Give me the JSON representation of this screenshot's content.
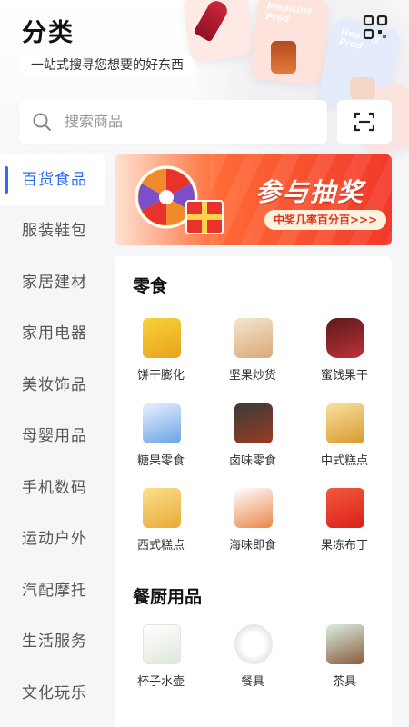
{
  "header": {
    "title": "分类",
    "subtitle": "一站式搜寻您想要的好东西",
    "deco_texts": [
      "Medicine Prod",
      "Healthy Prod"
    ]
  },
  "search": {
    "placeholder": "搜索商品"
  },
  "sidebar": {
    "items": [
      {
        "label": "百货食品",
        "active": true
      },
      {
        "label": "服装鞋包",
        "active": false
      },
      {
        "label": "家居建材",
        "active": false
      },
      {
        "label": "家用电器",
        "active": false
      },
      {
        "label": "美妆饰品",
        "active": false
      },
      {
        "label": "母婴用品",
        "active": false
      },
      {
        "label": "手机数码",
        "active": false
      },
      {
        "label": "运动户外",
        "active": false
      },
      {
        "label": "汽配摩托",
        "active": false
      },
      {
        "label": "生活服务",
        "active": false
      },
      {
        "label": "文化玩乐",
        "active": false
      }
    ]
  },
  "banner": {
    "title": "参与抽奖",
    "subtitle": "中奖几率百分百>>>"
  },
  "sections": [
    {
      "title": "零食",
      "items": [
        {
          "label": "饼干膨化",
          "color": "#f2c230"
        },
        {
          "label": "坚果炒货",
          "color": "#e9c9a0"
        },
        {
          "label": "蜜饯果干",
          "color": "#a8232c"
        },
        {
          "label": "糖果零食",
          "color": "#6aa3e6"
        },
        {
          "label": "卤味零食",
          "color": "#7a2a1c"
        },
        {
          "label": "中式糕点",
          "color": "#e7b84a"
        },
        {
          "label": "西式糕点",
          "color": "#f0b842"
        },
        {
          "label": "海味即食",
          "color": "#e9864a"
        },
        {
          "label": "果冻布丁",
          "color": "#e6352c"
        }
      ]
    },
    {
      "title": "餐厨用品",
      "items": [
        {
          "label": "杯子水壶",
          "color": "#e6eee0"
        },
        {
          "label": "餐具",
          "color": "#eeeeee"
        },
        {
          "label": "茶具",
          "color": "#c9e3d6"
        }
      ]
    }
  ],
  "colors": {
    "accent": "#2b6cf3",
    "banner_red": "#f2382a"
  }
}
